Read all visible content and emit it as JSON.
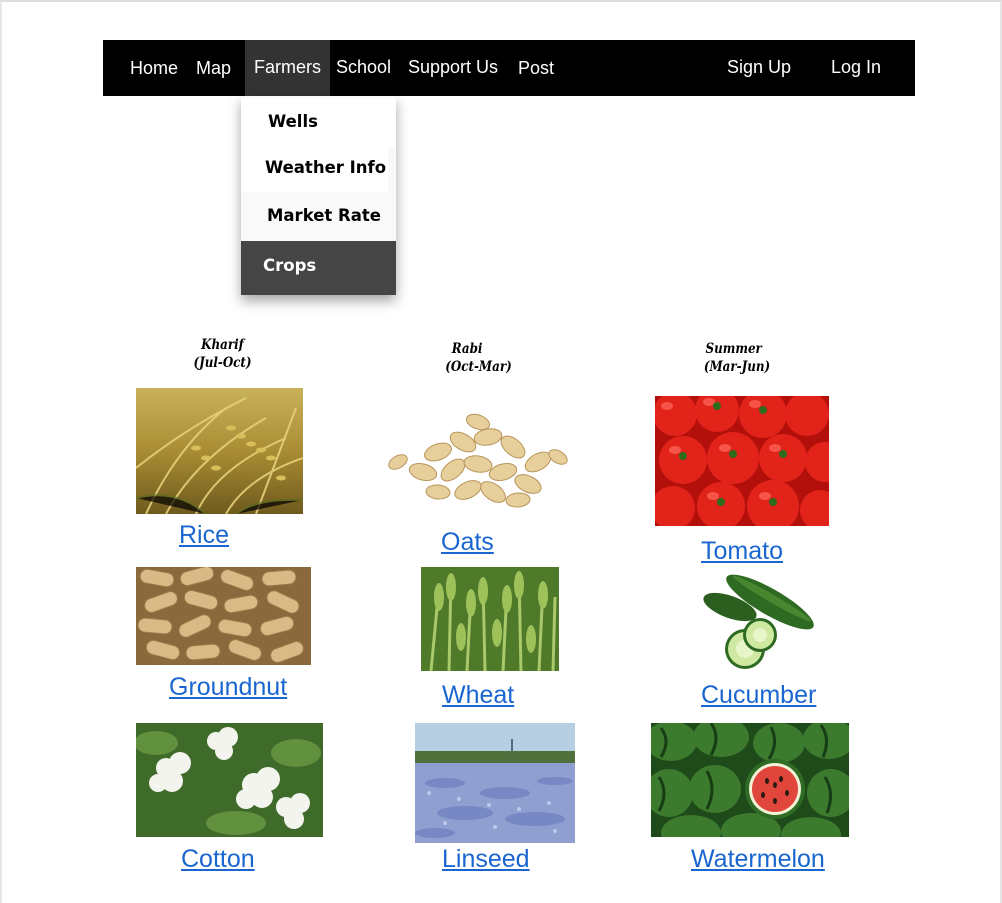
{
  "nav": {
    "home": "Home",
    "map": "Map",
    "farmers": "Farmers",
    "school": "School",
    "support": "Support Us",
    "post": "Post",
    "signup": "Sign Up",
    "login": "Log In"
  },
  "dropdown": {
    "wells": "Wells",
    "weather": "Weather Info",
    "market": "Market Rate",
    "crops": "Crops"
  },
  "seasons": {
    "kharif_name": "Kharif",
    "kharif_months": "(Jul-Oct)",
    "rabi_name": "Rabi",
    "rabi_months": "(Oct-Mar)",
    "summer_name": "Summer",
    "summer_months": "(Mar-Jun)"
  },
  "crops": {
    "rice": "Rice",
    "oats": "Oats",
    "tomato": "Tomato",
    "groundnut": "Groundnut",
    "wheat": "Wheat",
    "cucumber": "Cucumber",
    "cotton": "Cotton",
    "linseed": "Linseed",
    "watermelon": "Watermelon"
  },
  "colors": {
    "navbar": "#000000",
    "nav_active": "#333333",
    "dropdown_active": "#454545",
    "link": "#1a66d1"
  }
}
